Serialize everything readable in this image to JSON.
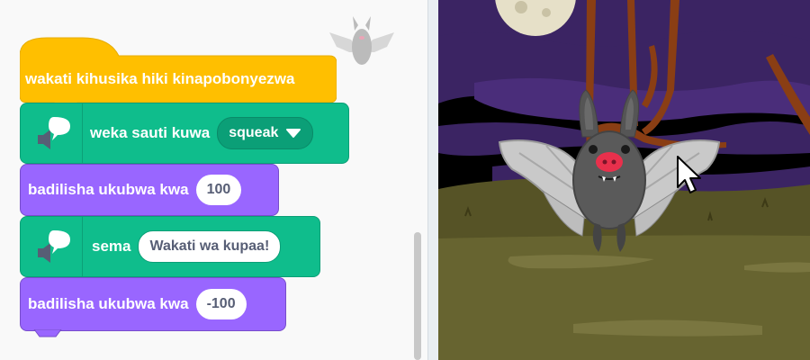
{
  "blocks": {
    "hat": "wakati kihusika hiki kinapobonyezwa",
    "sound_label": "weka sauti kuwa",
    "sound_value": "squeak",
    "size1_label": "badilisha ukubwa kwa",
    "size1_value": "100",
    "say_label": "sema",
    "say_value": "Wakati wa kupaa!",
    "size2_label": "badilisha ukubwa kwa",
    "size2_value": "-100"
  },
  "icons": {
    "speech": "speech-bubble-icon",
    "speaker": "speaker-icon",
    "dropdown": "caret-down-icon",
    "cursor": "mouse-pointer-icon"
  },
  "colors": {
    "events": "#ffbf00",
    "extension": "#0fbd8c",
    "looks": "#9966ff",
    "stage_sky": "#3b2463",
    "ground": "#5a5520"
  }
}
